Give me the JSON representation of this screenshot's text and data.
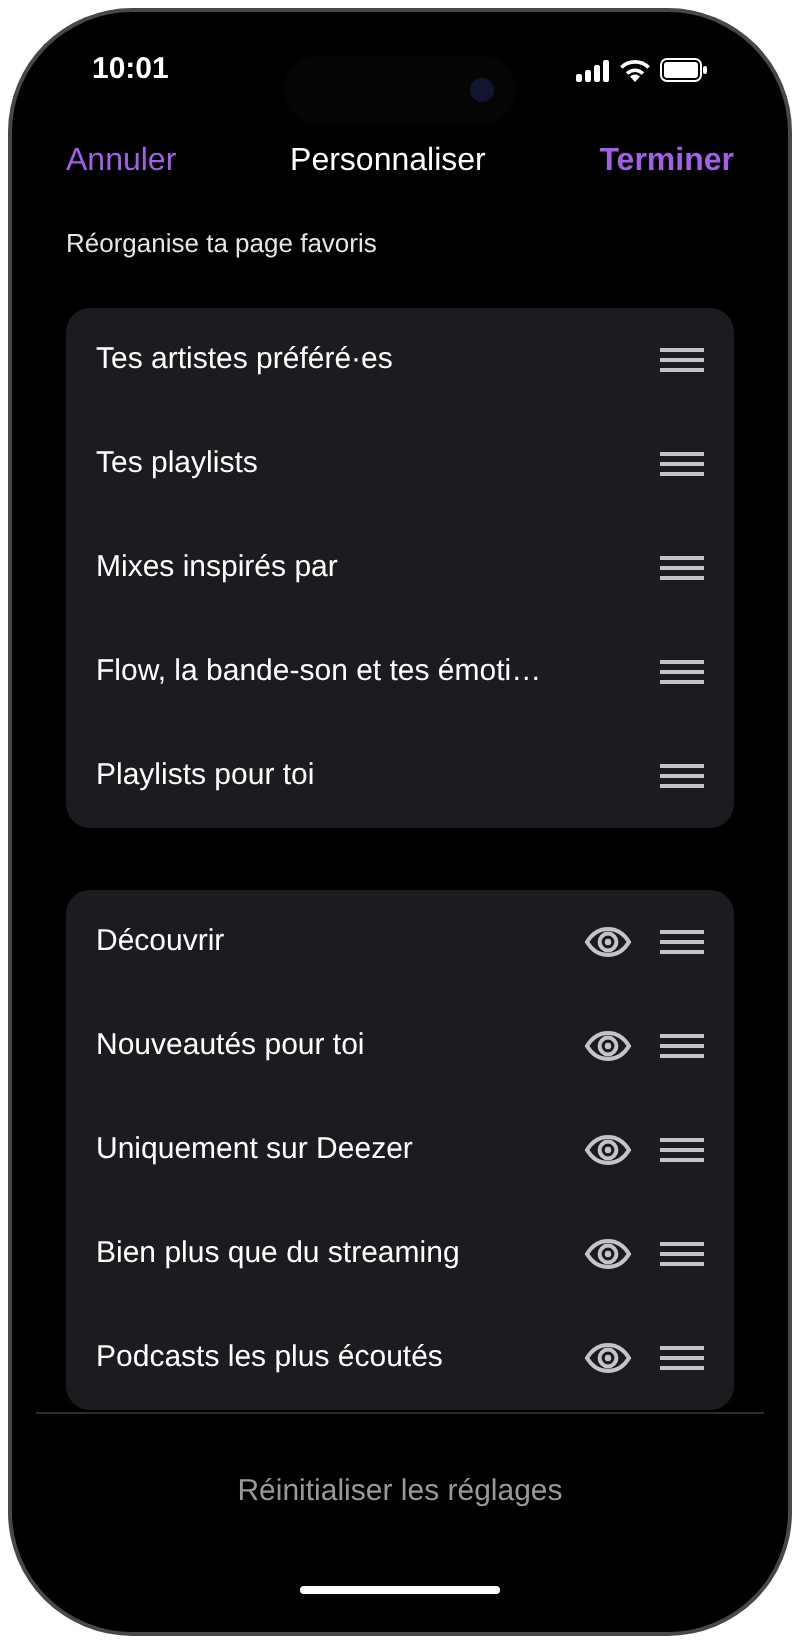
{
  "status_bar": {
    "time": "10:01"
  },
  "nav": {
    "cancel": "Annuler",
    "title": "Personnaliser",
    "done": "Terminer"
  },
  "subtitle": "Réorganise ta page favoris",
  "sections": [
    {
      "items": [
        {
          "label": "Tes artistes préféré·es",
          "kind": "fixed"
        },
        {
          "label": "Tes playlists",
          "kind": "fixed"
        },
        {
          "label": "Mixes inspirés par",
          "kind": "fixed"
        },
        {
          "label": "Flow, la bande-son et tes émoti…",
          "kind": "fixed"
        },
        {
          "label": "Playlists pour toi",
          "kind": "fixed"
        }
      ]
    },
    {
      "items": [
        {
          "label": "Découvrir",
          "kind": "toggle",
          "visible": true
        },
        {
          "label": "Nouveautés pour toi",
          "kind": "toggle",
          "visible": true
        },
        {
          "label": "Uniquement sur Deezer",
          "kind": "toggle",
          "visible": true
        },
        {
          "label": "Bien plus que du streaming",
          "kind": "toggle",
          "visible": true
        },
        {
          "label": "Podcasts les plus écoutés",
          "kind": "toggle",
          "visible": true
        }
      ]
    }
  ],
  "footer": {
    "reset": "Réinitialiser les réglages"
  }
}
